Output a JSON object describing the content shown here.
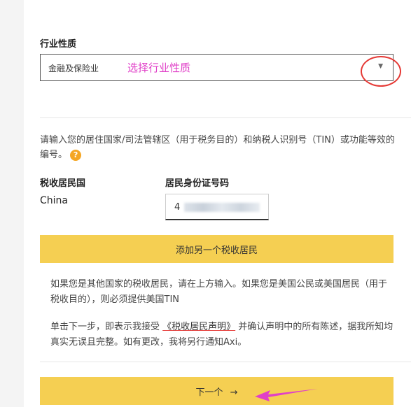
{
  "industry": {
    "label": "行业性质",
    "selected_value": "金融及保险业",
    "annotation": "选择行业性质",
    "caret_icon": "caret-down-icon"
  },
  "tax_instruction": {
    "text": "请输入您的居住国家/司法管辖区（用于税务目的）和纳税人识别号（TIN）或功能等效的编号。",
    "help_icon_text": "?"
  },
  "tax_residency": {
    "country_header": "税收居民国",
    "tin_header": "居民身份证号码",
    "country_value": "China",
    "tin_value_visible": "4"
  },
  "buttons": {
    "add_resident": "添加另一个税收居民",
    "next": "下一个",
    "next_arrow": "→"
  },
  "notices": {
    "us_person": "如果您是其他国家的税收居民，请在上方输入。如果您是美国公民或美国居民（用于税收目的），则必须提供美国TIN",
    "declaration_prefix": "单击下一步，即表示我接受 ",
    "declaration_link": "《税收居民声明》",
    "declaration_suffix": " 并确认声明中的所有陈述，据我所知均真实无误且完整。如有更改，我将另行通知Axi。"
  },
  "colors": {
    "accent_yellow": "#f5cf52",
    "annotation_pink": "#e040c8",
    "annotation_red": "#e53935",
    "help_orange": "#f5a623"
  }
}
